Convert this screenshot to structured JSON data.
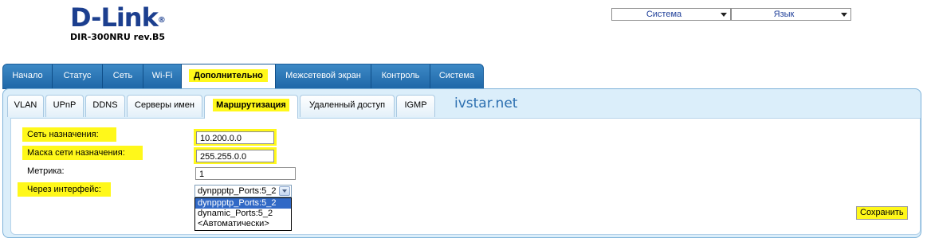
{
  "header": {
    "brand": "D-Link",
    "brand_mark": "®",
    "model": "DIR-300NRU rev.B5",
    "system_select": "Система",
    "language_select": "Язык"
  },
  "top_tabs": [
    {
      "label": "Начало"
    },
    {
      "label": "Статус"
    },
    {
      "label": "Сеть"
    },
    {
      "label": "Wi-Fi"
    },
    {
      "label": "Дополнительно",
      "active": true
    },
    {
      "label": "Межсетевой экран"
    },
    {
      "label": "Контроль"
    },
    {
      "label": "Система"
    }
  ],
  "sub_tabs": [
    {
      "label": "VLAN"
    },
    {
      "label": "UPnP"
    },
    {
      "label": "DDNS"
    },
    {
      "label": "Серверы имен"
    },
    {
      "label": "Маршрутизация",
      "active": true
    },
    {
      "label": "Удаленный доступ"
    },
    {
      "label": "IGMP"
    }
  ],
  "watermark": "ivstar.net",
  "form": {
    "destination_label": "Сеть назначения:",
    "destination_value": "10.200.0.0",
    "mask_label": "Маска сети назначения:",
    "mask_value": "255.255.0.0",
    "metric_label": "Метрика:",
    "metric_value": "1",
    "interface_label": "Через интерфейс:",
    "interface_selected": "dynppptp_Ports:5_2",
    "interface_options": [
      "dynppptp_Ports:5_2",
      "dynamic_Ports:5_2",
      "<Автоматически>"
    ]
  },
  "save_label": "Сохранить",
  "colors": {
    "highlight": "#fff81a",
    "tab_bar": "#2a75b8",
    "panel_bg": "#dbeefa",
    "logo": "#1c3f8f",
    "selection": "#3169c6"
  }
}
